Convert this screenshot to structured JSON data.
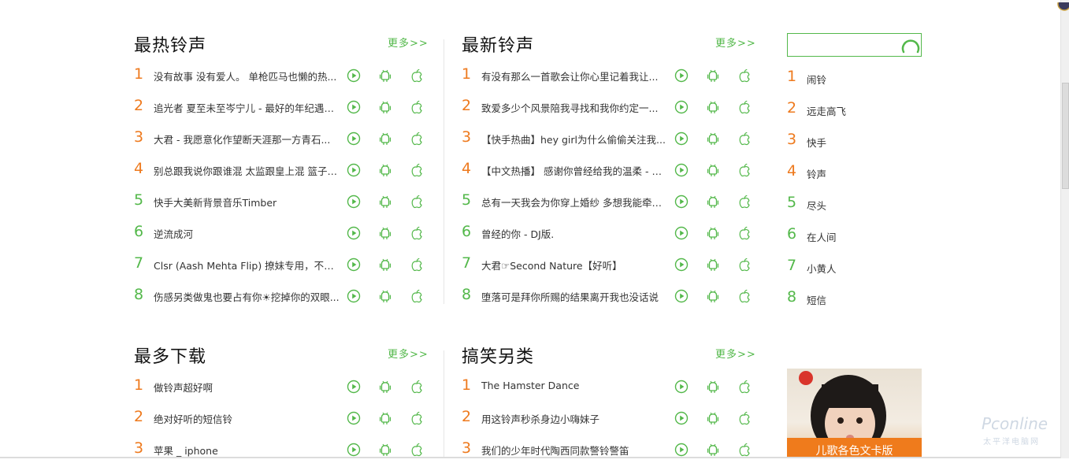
{
  "sections": [
    {
      "title": "最热铃声",
      "more": "更多>>",
      "items": [
        {
          "rank": "1",
          "title": "没有故事 没有爱人。 单枪匹马也懒的热..."
        },
        {
          "rank": "2",
          "title": "追光者 夏至未至岑宁儿 - 最好的年纪遇见..."
        },
        {
          "rank": "3",
          "title": "大君 - 我愿意化作望断天涯那一方青石..."
        },
        {
          "rank": "4",
          "title": "别总跟我说你跟谁混 太监跟皇上混 篮子不..."
        },
        {
          "rank": "5",
          "title": "快手大美新背景音乐Timber"
        },
        {
          "rank": "6",
          "title": "逆流成河"
        },
        {
          "rank": "7",
          "title": "Clsr (Aash Mehta Flip) 撩妹专用，不好听..."
        },
        {
          "rank": "8",
          "title": "伤感另类做鬼也要占有你☀挖掉你的双眼..."
        }
      ]
    },
    {
      "title": "最新铃声",
      "more": "更多>>",
      "items": [
        {
          "rank": "1",
          "title": "有没有那么一首歌会让你心里记着我让..."
        },
        {
          "rank": "2",
          "title": "致爱多少个风景陪我寻找和我你约定一..."
        },
        {
          "rank": "3",
          "title": "【快手热曲】hey girl为什么偷偷关注我..."
        },
        {
          "rank": "4",
          "title": "【中文热播】 感谢你曾经给我的温柔 - 终章"
        },
        {
          "rank": "5",
          "title": "总有一天我会为你穿上婚纱 多想我能牵着..."
        },
        {
          "rank": "6",
          "title": "曾经的你 - DJ版."
        },
        {
          "rank": "7",
          "title": "大君☞Second Nature【好听】"
        },
        {
          "rank": "8",
          "title": "堕落可是拜你所赐的结果离开我也没话说"
        }
      ]
    },
    {
      "title": "最多下载",
      "more": "更多>>",
      "items": [
        {
          "rank": "1",
          "title": "做铃声超好啊"
        },
        {
          "rank": "2",
          "title": "绝对好听的短信铃"
        },
        {
          "rank": "3",
          "title": "苹果 _ iphone"
        }
      ]
    },
    {
      "title": "搞笑另类",
      "more": "更多>>",
      "items": [
        {
          "rank": "1",
          "title": "The Hamster Dance"
        },
        {
          "rank": "2",
          "title": "用这铃声秒杀身边小嗨妹子"
        },
        {
          "rank": "3",
          "title": "我们的少年时代陶西同款警铃警笛"
        }
      ]
    }
  ],
  "search": {
    "value": "",
    "placeholder": ""
  },
  "keywords": [
    {
      "rank": "1",
      "label": "闹铃"
    },
    {
      "rank": "2",
      "label": "远走高飞"
    },
    {
      "rank": "3",
      "label": "快手"
    },
    {
      "rank": "4",
      "label": "铃声"
    },
    {
      "rank": "5",
      "label": "尽头"
    },
    {
      "rank": "6",
      "label": "在人间"
    },
    {
      "rank": "7",
      "label": "小黄人"
    },
    {
      "rank": "8",
      "label": "短信"
    }
  ],
  "promo": {
    "caption": "儿歌各色文卡版"
  },
  "watermark": {
    "brand": "Pconline",
    "sub": "太平洋电脑网"
  },
  "colors": {
    "accent_green": "#53b84a",
    "rank_orange": "#ee7a1e"
  }
}
